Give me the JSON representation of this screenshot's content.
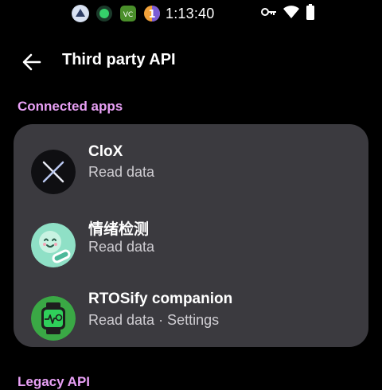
{
  "status_bar": {
    "time": "1:13:40",
    "left_icons": [
      "app-notification-icon",
      "record-icon",
      "vs-app-icon",
      "number-badge-icon"
    ],
    "right_icons": [
      "key-icon",
      "wifi-icon",
      "battery-icon"
    ]
  },
  "app_bar": {
    "title": "Third party API",
    "back_icon": "back-arrow-icon"
  },
  "sections": {
    "connected": {
      "header": "Connected apps",
      "apps": [
        {
          "name": "CloX",
          "permission": "Read data",
          "icon": "clox-app-icon"
        },
        {
          "name": "情绪检测",
          "permission": "Read data",
          "icon": "mood-app-icon"
        },
        {
          "name": "RTOSify companion",
          "permission": "Read data · Settings",
          "icon": "rtosify-app-icon"
        }
      ]
    },
    "legacy": {
      "header": "Legacy API"
    }
  },
  "colors": {
    "background": "#000000",
    "card": "#3b3a3f",
    "accent": "#e8a0f5",
    "secondary_text": "#cfcdd2",
    "rtosify_green": "#3aa845",
    "mood_teal": "#8fe0c6"
  }
}
